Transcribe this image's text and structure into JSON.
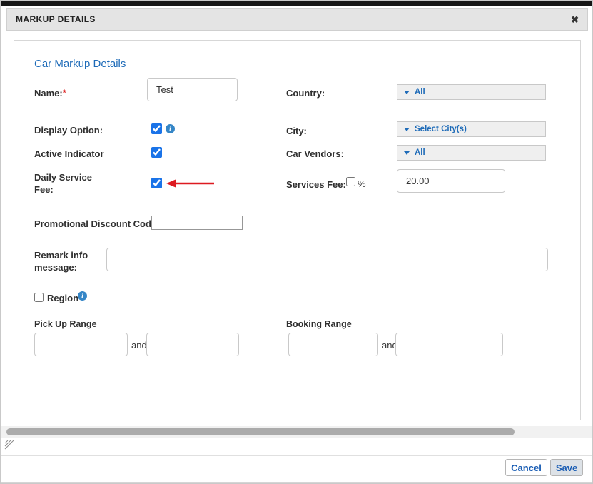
{
  "modal": {
    "title": "MARKUP DETAILS",
    "close_glyph": "✖"
  },
  "form": {
    "heading": "Car Markup Details",
    "info_glyph": "i",
    "name": {
      "label": "Name:",
      "required_mark": "*",
      "value": "Test"
    },
    "country": {
      "label": "Country:",
      "selected": "All"
    },
    "display_option": {
      "label": "Display Option:",
      "checked": "checked"
    },
    "city": {
      "label": "City:",
      "selected": "Select City(s)"
    },
    "active_indicator": {
      "label": "Active Indicator",
      "checked": "checked"
    },
    "car_vendors": {
      "label": "Car Vendors:",
      "selected": "All"
    },
    "daily_service_fee": {
      "label": "Daily Service Fee:",
      "checked": "checked"
    },
    "services_fee": {
      "label": "Services Fee:",
      "percent_label": "%",
      "value": "20.00"
    },
    "promo_code": {
      "label": "Promotional Discount Code:",
      "value": ""
    },
    "remark": {
      "label": "Remark info message:",
      "value": ""
    },
    "region": {
      "label": "Region"
    },
    "pick_up_range": {
      "label": "Pick Up Range",
      "and_label": "and",
      "from_value": "",
      "to_value": ""
    },
    "booking_range": {
      "label": "Booking Range",
      "and_label": "and",
      "from_value": "",
      "to_value": ""
    }
  },
  "footer": {
    "cancel_label": "Cancel",
    "save_label": "Save"
  },
  "colors": {
    "accent_blue": "#1e6bb8",
    "checkbox_blue": "#1a73e8",
    "arrow_red": "#dd1a21",
    "header_bg": "#e4e4e4"
  }
}
